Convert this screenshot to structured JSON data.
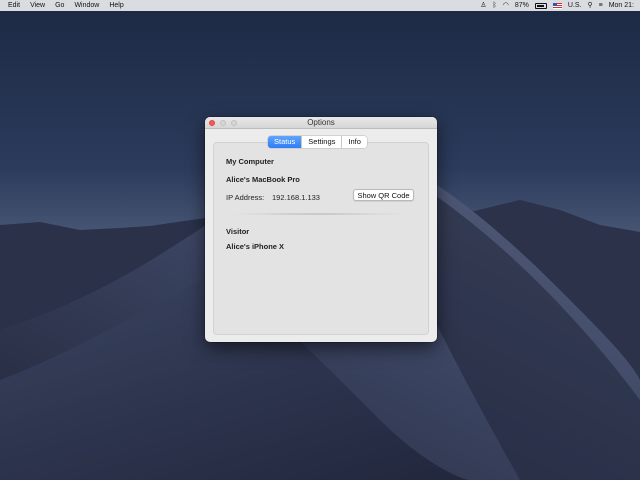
{
  "menubar": {
    "items": [
      "Edit",
      "View",
      "Go",
      "Window",
      "Help"
    ],
    "battery_percent": "87%",
    "input_source": "U.S.",
    "clock": "Mon 21:",
    "icons": [
      "person-icon",
      "bluetooth-icon",
      "wifi-icon",
      "battery-icon",
      "flag-icon",
      "search-icon",
      "siri-icon"
    ]
  },
  "window": {
    "title": "Options",
    "tabs": [
      {
        "label": "Status",
        "active": true
      },
      {
        "label": "Settings",
        "active": false
      },
      {
        "label": "Info",
        "active": false
      }
    ],
    "my_computer_heading": "My Computer",
    "computer_name": "Alice's MacBook Pro",
    "ip_label": "IP Address:",
    "ip_value": "192.168.1.133",
    "qr_button": "Show QR Code",
    "visitor_heading": "Visitor",
    "visitor_name": "Alice's iPhone X"
  },
  "colors": {
    "accent": "#2f7cf6",
    "close_button": "#fc5753"
  }
}
